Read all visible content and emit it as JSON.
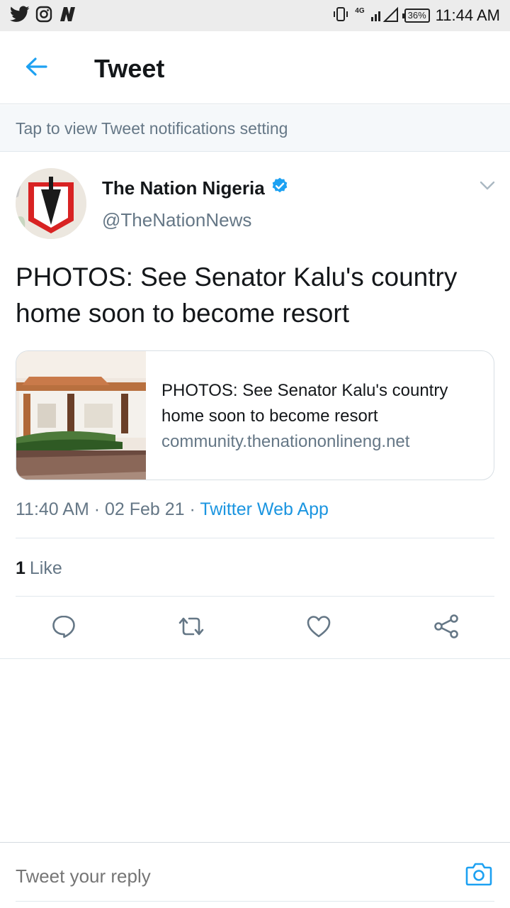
{
  "status_bar": {
    "time": "11:44 AM",
    "battery": "36%",
    "network": "4G",
    "left_icons": [
      "twitter-bird-icon",
      "instagram-icon",
      "nation-n-icon"
    ],
    "right_icons": [
      "vibrate-icon",
      "signal-icon",
      "battery-icon"
    ]
  },
  "header": {
    "title": "Tweet",
    "back_icon": "back-arrow-icon"
  },
  "notification_banner": {
    "text": "Tap to view Tweet notifications setting"
  },
  "tweet": {
    "author": {
      "name": "The Nation Nigeria",
      "handle": "@TheNationNews",
      "verified": true
    },
    "text": "PHOTOS: See Senator Kalu's country home soon to become resort",
    "card": {
      "title": "PHOTOS: See Senator Kalu's country home soon to become resort",
      "domain": "community.thenationonlineng.net"
    },
    "meta": {
      "time": "11:40 AM",
      "date": "02 Feb 21",
      "separator": " · ",
      "source": "Twitter Web App"
    },
    "likes": {
      "count": "1",
      "label": "Like"
    },
    "actions": [
      "reply-icon",
      "retweet-icon",
      "like-icon",
      "share-icon"
    ]
  },
  "reply": {
    "placeholder": "Tweet your reply",
    "camera_icon": "camera-icon"
  },
  "colors": {
    "accent": "#1da1f2",
    "link": "#1b95e0",
    "secondary_text": "#657786",
    "primary_text": "#14171a",
    "banner_bg": "#f5f8fa",
    "status_bar_bg": "#ececec"
  }
}
